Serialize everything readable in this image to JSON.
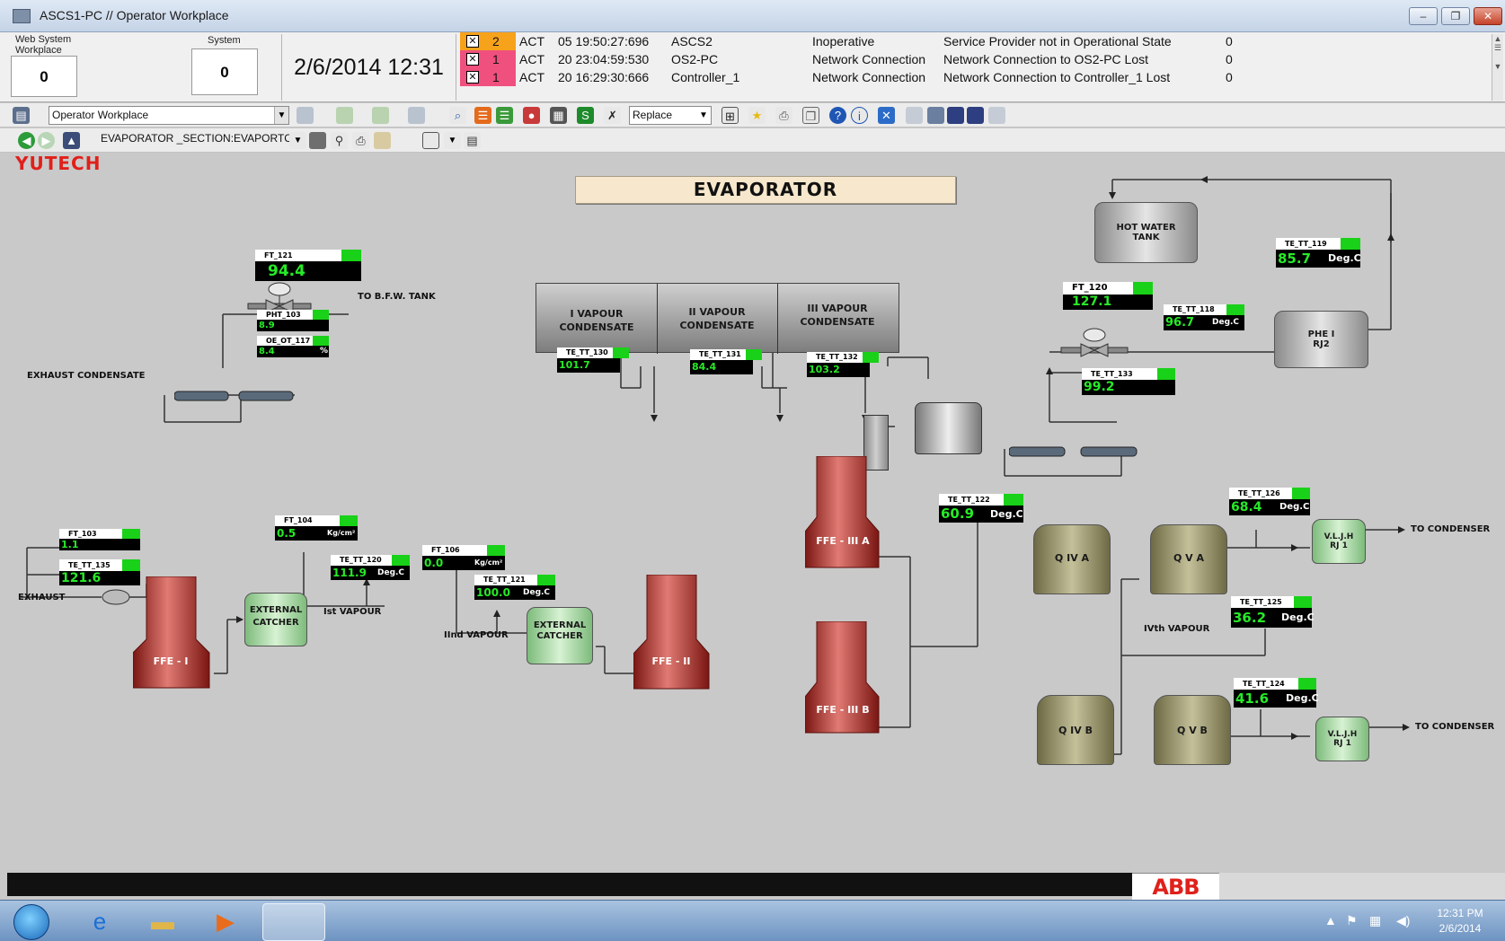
{
  "window": {
    "title": "ASCS1-PC // Operator Workplace",
    "buttons": [
      "–",
      "❐",
      "✕"
    ]
  },
  "counters": [
    {
      "label": "Web System Workplace",
      "value": "0"
    },
    {
      "label": "System",
      "value": "0"
    }
  ],
  "datetime": "2/6/2014 12:31",
  "alarms": [
    {
      "priority": "2",
      "status": "ACT",
      "time": "05 19:50:27:696",
      "object": "ASCS2",
      "category": "Inoperative",
      "message": "Service Provider not in Operational State",
      "count": "0",
      "color": "#f7a21b"
    },
    {
      "priority": "1",
      "status": "ACT",
      "time": "20 23:04:59:530",
      "object": "OS2-PC",
      "category": "Network Connection",
      "message": "Network Connection to OS2-PC Lost",
      "count": "0",
      "color": "#f0507e"
    },
    {
      "priority": "1",
      "status": "ACT",
      "time": "20 16:29:30:666",
      "object": "Controller_1",
      "category": "Network Connection",
      "message": "Network Connection to Controller_1 Lost",
      "count": "0",
      "color": "#f0507e"
    }
  ],
  "toolbar": {
    "workplace_select": "Operator Workplace",
    "replace_select": "Replace",
    "path": "EVAPORATOR _SECTION:EVAPORTC"
  },
  "process": {
    "brand": "YUTECH",
    "banner": "EVAPORATOR",
    "labels": {
      "to_bfw_tank": "TO B.F.W. TANK",
      "exhaust_condensate": "EXHAUST CONDENSATE",
      "exhaust": "EXHAUST",
      "first_vapour": "Ist VAPOUR",
      "second_vapour": "IInd VAPOUR",
      "fourth_vapour": "IVth VAPOUR",
      "to_condenser_1": "TO CONDENSER",
      "to_condenser_2": "TO CONDENSER"
    },
    "condensate": [
      "I VAPOUR CONDENSATE",
      "II VAPOUR CONDENSATE",
      "III VAPOUR CONDENSATE"
    ],
    "vessels": {
      "ffe1": "FFE - I",
      "ffe2": "FFE - II",
      "ffe3a": "FFE - III A",
      "ffe3b": "FFE - III B",
      "ext_catcher_1": "EXTERNAL CATCHER",
      "ext_catcher_2": "EXTERNAL CATCHER",
      "hot_water_tank": "HOT WATER TANK",
      "phe": "PHE I RJ2",
      "q4a": "Q IV A",
      "q5a": "Q V A",
      "q4b": "Q IV B",
      "q5b": "Q V B",
      "vljh1": "V.L.J.H RJ 1",
      "vljh2": "V.L.J.H RJ 1"
    },
    "tags": {
      "ft121": {
        "name": "FT_121",
        "value": "94.4",
        "unit": ""
      },
      "pht103": {
        "name": "PHT_103",
        "value": "8.9",
        "unit": ""
      },
      "oeot117": {
        "name": "OE_OT_117",
        "value": "8.4",
        "unit": "%"
      },
      "ft103": {
        "name": "FT_103",
        "value": "1.1",
        "unit": ""
      },
      "tett135": {
        "name": "TE_TT_135",
        "value": "121.6",
        "unit": ""
      },
      "ft104": {
        "name": "FT_104",
        "value": "0.5",
        "unit": "Kg/cm²"
      },
      "tett120": {
        "name": "TE_TT_120",
        "value": "111.9",
        "unit": "Deg.C"
      },
      "ft106": {
        "name": "FT_106",
        "value": "0.0",
        "unit": "Kg/cm²"
      },
      "tett121": {
        "name": "TE_TT_121",
        "value": "100.0",
        "unit": "Deg.C"
      },
      "tett130": {
        "name": "TE_TT_130",
        "value": "101.7",
        "unit": ""
      },
      "tett131": {
        "name": "TE_TT_131",
        "value": "84.4",
        "unit": ""
      },
      "tett132": {
        "name": "TE_TT_132",
        "value": "103.2",
        "unit": ""
      },
      "ft120": {
        "name": "FT_120",
        "value": "127.1",
        "unit": ""
      },
      "tett118": {
        "name": "TE_TT_118",
        "value": "96.7",
        "unit": "Deg.C"
      },
      "tett119": {
        "name": "TE_TT_119",
        "value": "85.7",
        "unit": "Deg.C"
      },
      "tett133": {
        "name": "TE_TT_133",
        "value": "99.2",
        "unit": ""
      },
      "tett122": {
        "name": "TE_TT_122",
        "value": "60.9",
        "unit": "Deg.C"
      },
      "tett126": {
        "name": "TE_TT_126",
        "value": "68.4",
        "unit": "Deg.C"
      },
      "tett125": {
        "name": "TE_TT_125",
        "value": "36.2",
        "unit": "Deg.C"
      },
      "tett124": {
        "name": "TE_TT_124",
        "value": "41.6",
        "unit": "Deg.C"
      }
    }
  },
  "status": {
    "logo": "ABB"
  },
  "taskbar": {
    "time": "12:31 PM",
    "date": "2/6/2014"
  }
}
